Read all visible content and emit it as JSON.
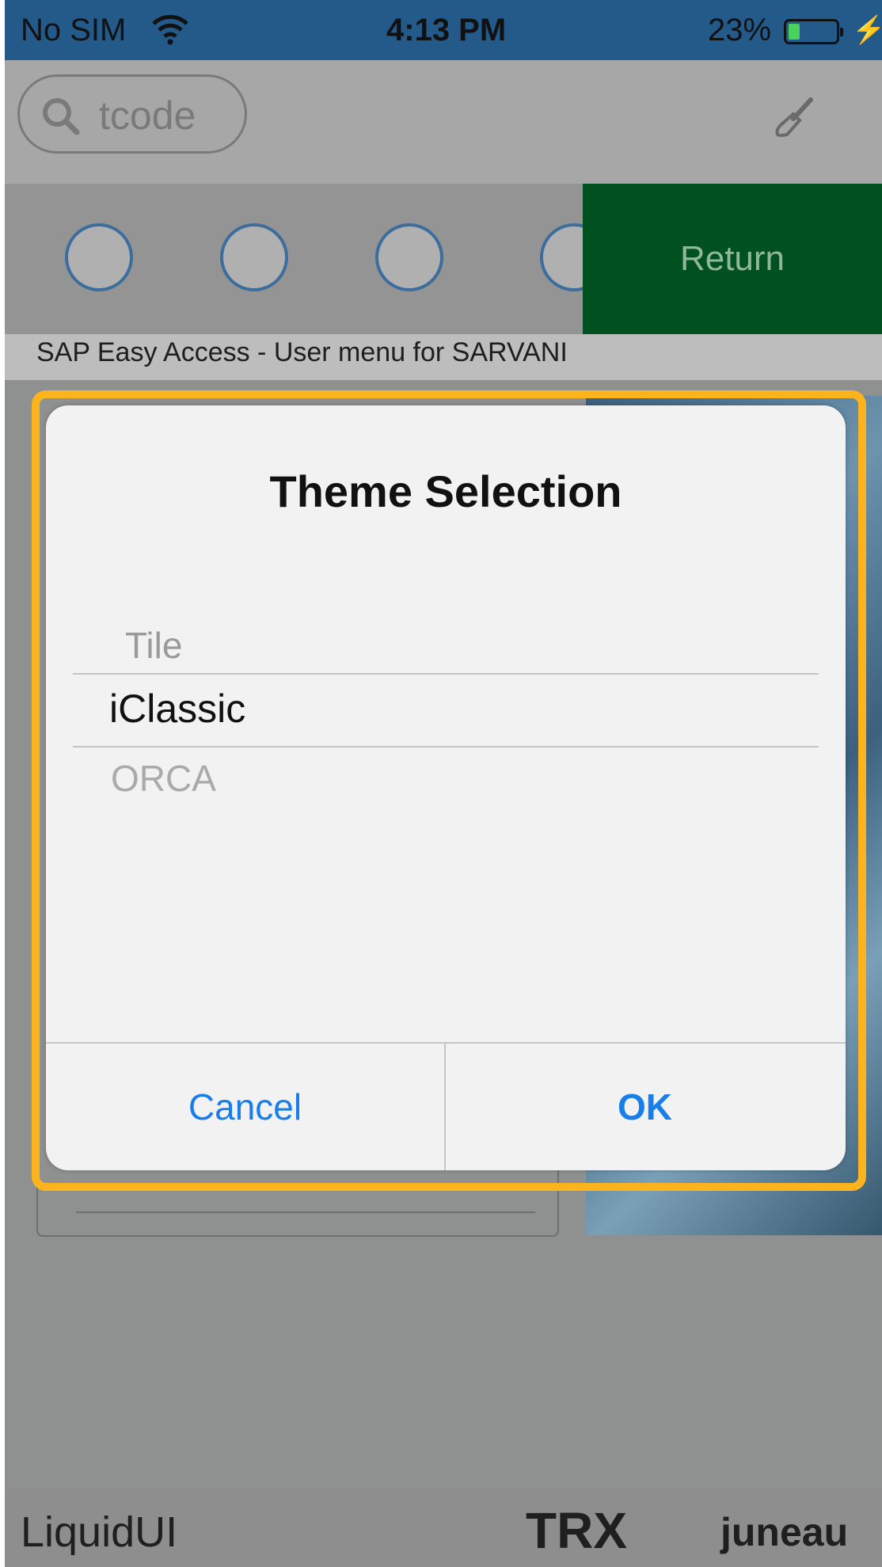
{
  "status_bar": {
    "carrier": "No SIM",
    "time": "4:13 PM",
    "battery_percent": "23%",
    "battery_level": 0.23,
    "icons": [
      "wifi-icon",
      "battery-icon",
      "charging-icon"
    ]
  },
  "search": {
    "placeholder": "tcode",
    "icon": "search-icon"
  },
  "settings_icon": "brush-icon",
  "toolbar": {
    "icons": [
      "user-menu-icon",
      "sap-menu-icon",
      "favorites-icon",
      "assign-users-icon"
    ],
    "return_label": "Return"
  },
  "page": {
    "subtitle": "SAP Easy Access  -  User menu for SARVANI"
  },
  "dialog": {
    "title": "Theme Selection",
    "options": [
      "Tile",
      "iClassic",
      "ORCA"
    ],
    "selected": "iClassic",
    "cancel_label": "Cancel",
    "ok_label": "OK"
  },
  "footer": {
    "brand": "LiquidUI",
    "mode": "TRX",
    "server": "juneau"
  },
  "colors": {
    "status_bar": "#245a8a",
    "return_button": "#005020",
    "highlight": "#fbb41d",
    "dialog_button_text": "#1a7ee8"
  }
}
